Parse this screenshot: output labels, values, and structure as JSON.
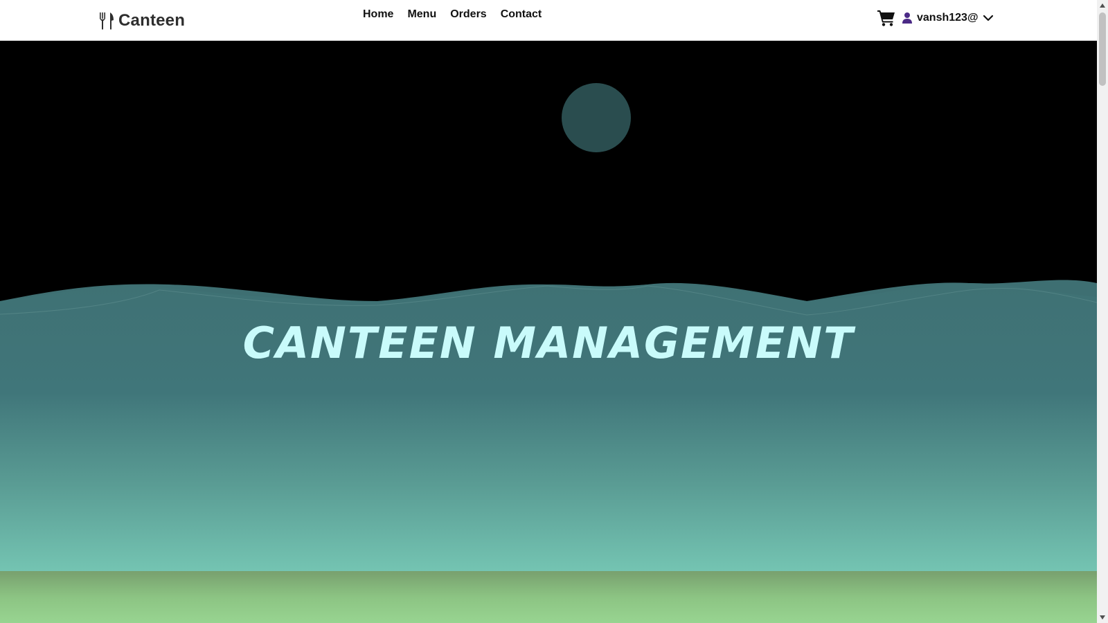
{
  "navbar": {
    "brand": {
      "icon": "utensils-icon",
      "name": "Canteen"
    },
    "links": [
      "Home",
      "Menu",
      "Orders",
      "Contact"
    ],
    "cart": {
      "icon": "shopping-cart-icon"
    },
    "user": {
      "icon": "user-icon",
      "name": "vansh123@",
      "dropdown_icon": "chevron-down-icon"
    }
  },
  "hero": {
    "title": "CANTEEN MANAGEMENT"
  },
  "colors": {
    "navbar_bg": "#ffffff",
    "sky": "#000000",
    "moon": "#2a4d4f",
    "sea_top": "#3f7174",
    "sea_bottom": "#74c4b2",
    "ground": "#8cc483",
    "title": "#c9fbfb"
  },
  "scrollbar": {
    "up_icon": "scroll-up-arrow-icon",
    "down_icon": "scroll-down-arrow-icon",
    "scroll_position": 0
  }
}
